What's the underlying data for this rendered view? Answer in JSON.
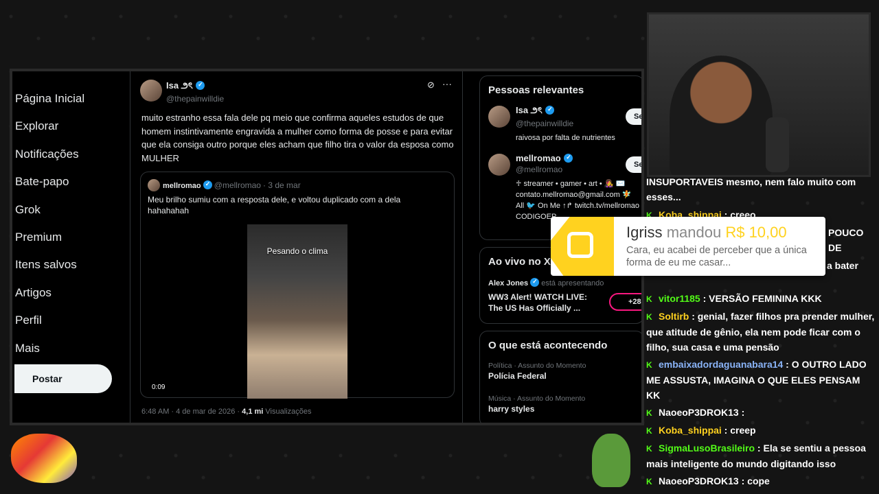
{
  "nav": {
    "items": [
      "Página Inicial",
      "Explorar",
      "Notificações",
      "Bate-papo",
      "Grok",
      "Premium",
      "Itens salvos",
      "Artigos",
      "Perfil",
      "Mais"
    ],
    "post_label": "Postar"
  },
  "tweet": {
    "name": "Isa ౨ৎ",
    "handle": "@thepainwilldie",
    "text": "muito estranho essa fala dele pq meio que confirma aqueles estudos de que homem instintivamente engravida a mulher como forma de posse e para evitar que ela consiga outro porque eles acham que filho tira o valor da esposa como MULHER",
    "quote": {
      "name": "mellromao",
      "handle": "@mellromao",
      "date": "· 3 de mar",
      "text": "Meu brilho sumiu com a resposta dele, e voltou duplicado com a dela hahahahah",
      "video_caption": "Pesando o clima",
      "video_time": "0:09"
    },
    "time": "6:48 AM · 4 de mar de 2026 ·",
    "views_count": "4,1 mi",
    "views_label": "Visualizações"
  },
  "relevant": {
    "title": "Pessoas relevantes",
    "people": [
      {
        "name": "Isa ౨ৎ",
        "handle": "@thepainwilldie",
        "bio": "raivosa por falta de nutrientes",
        "follow": "Se"
      },
      {
        "name": "mellromao",
        "handle": "@mellromao",
        "bio_lines": [
          "♱ streamer • gamer • art • 👩‍🎤 ✉️",
          "contato.mellromao@gmail.com 🧚",
          "All 🐦 On Me ↑↱ twitch.tv/mellromao",
          "CODIGOEP"
        ],
        "follow": "Se"
      }
    ]
  },
  "live": {
    "title": "Ao vivo no X",
    "host": "Alex Jones",
    "presenting": "está apresentando",
    "headline": "WW3 Alert! WATCH LIVE: The US Has Officially ...",
    "count": "+28"
  },
  "trending": {
    "title": "O que está acontecendo",
    "items": [
      {
        "meta": "Política · Assunto do Momento",
        "topic": "Polícia Federal"
      },
      {
        "meta": "Música · Assunto do Momento",
        "topic": "harry styles"
      }
    ]
  },
  "alert": {
    "user": "Igriss",
    "verb": "mandou",
    "amount": "R$ 10,00",
    "message": "Cara, eu acabei de perceber que a única forma de eu me casar..."
  },
  "chat": [
    {
      "text": "INSUPORTAVEIS mesmo, nem falo muito com esses..."
    },
    {
      "user": "Koba_shippai",
      "color": "#ffd21f",
      "msg": "creeo"
    },
    {
      "tail": "POUCO DE"
    },
    {
      "tail": "seja lá o nome não errou, vou começar a bater"
    },
    {
      "user": "vitor1185",
      "color": "#53fc18",
      "msg": "VERSÃO FEMININA KKK"
    },
    {
      "user": "Soltirb",
      "color": "#ffd21f",
      "msg": "genial, fazer filhos pra prender mulher, que atitude de gênio, ela nem pode ficar com o filho, sua casa e uma pensão"
    },
    {
      "user": "embaixadordaguanabara14",
      "color": "#8ab4f8",
      "msg": "O OUTRO LADO ME ASSUSTA, IMAGINA O QUE ELES PENSAM KK"
    },
    {
      "user": "NaoeoP3DROK13",
      "color": "#ffffff",
      "msg": ""
    },
    {
      "user": "Koba_shippai",
      "color": "#ffd21f",
      "msg": "creep"
    },
    {
      "user": "SigmaLusoBrasileiro",
      "color": "#53fc18",
      "msg": "Ela se sentiu a pessoa mais inteligente do mundo digitando isso"
    },
    {
      "user": "NaoeoP3DROK13",
      "color": "#ffffff",
      "msg": "cope"
    }
  ],
  "colors": {
    "verified": "#1d9bf0",
    "kick": "#53fc18",
    "alert_yellow": "#ffd21f"
  }
}
